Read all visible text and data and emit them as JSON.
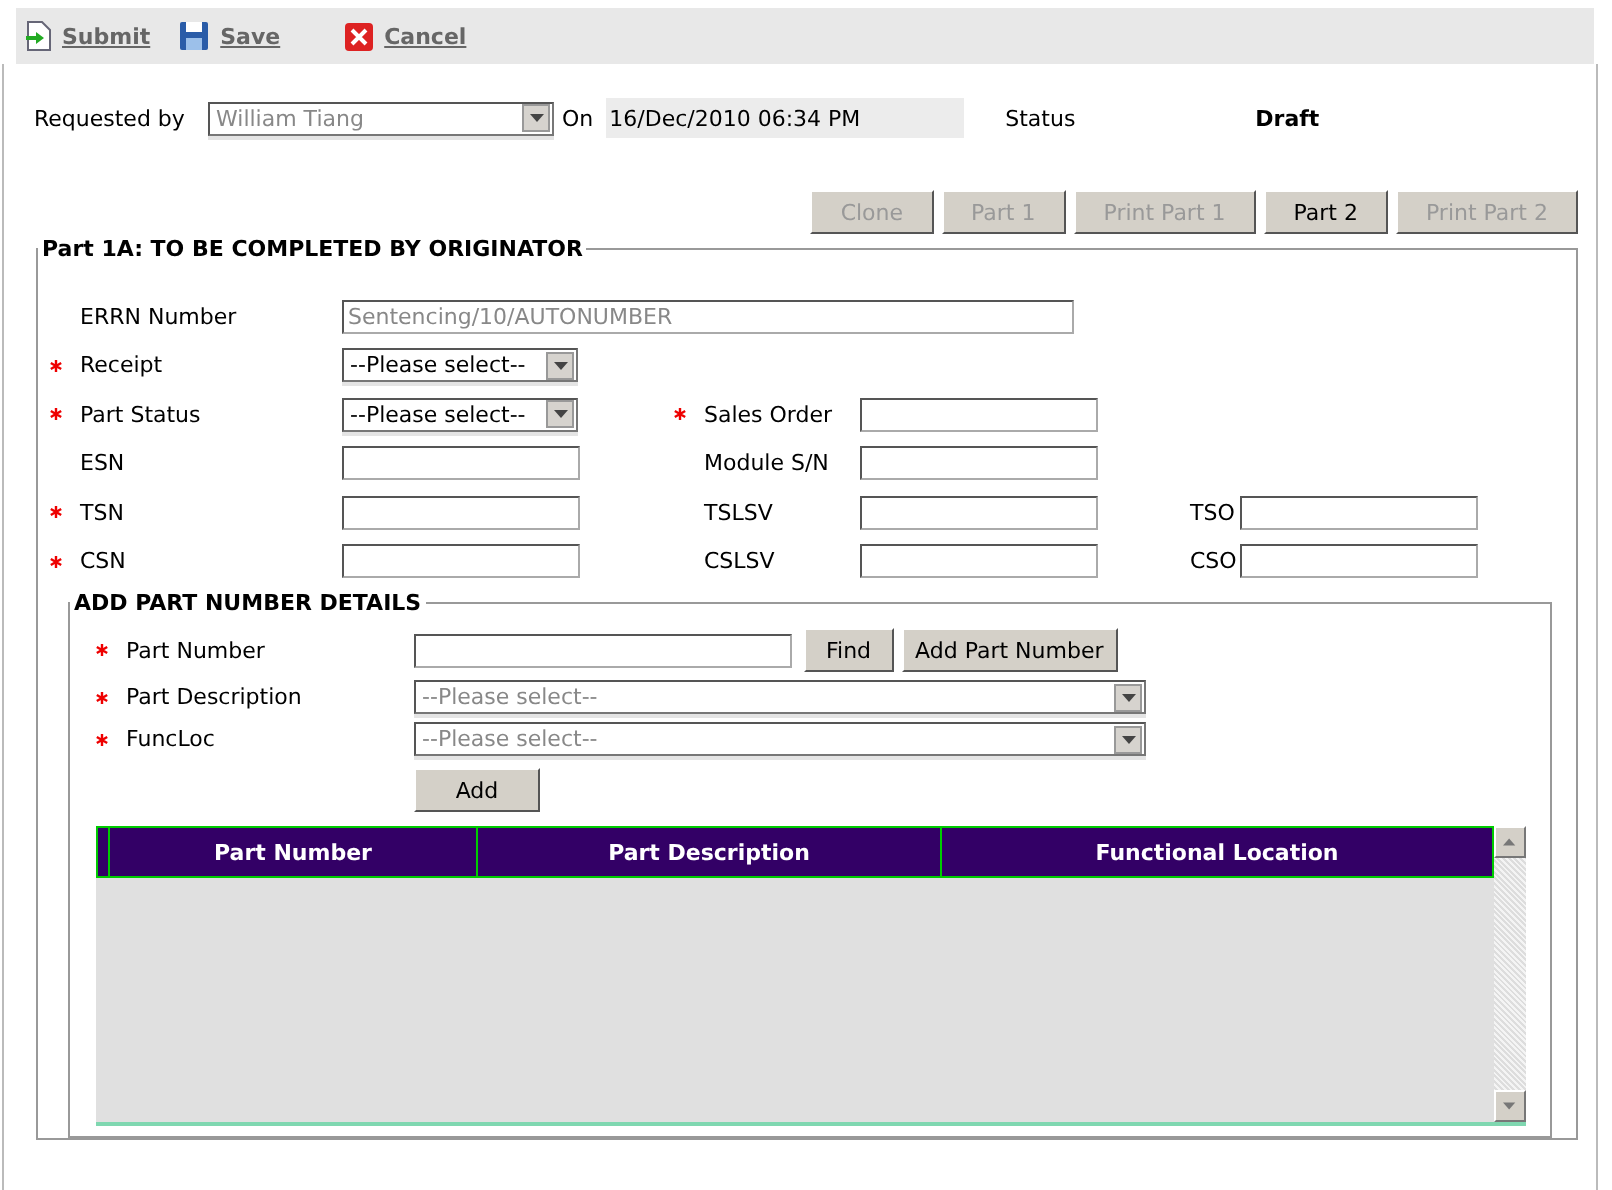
{
  "toolbar": [
    {
      "kind": "submit",
      "label": "Submit"
    },
    {
      "kind": "save",
      "label": "Save"
    },
    {
      "kind": "cancel",
      "label": "Cancel"
    }
  ],
  "header": {
    "requested_by_label": "Requested by",
    "requested_by": "William Tiang",
    "on_label": "On",
    "date": "16/Dec/2010 06:34 PM",
    "status_label": "Status",
    "status": "Draft"
  },
  "buttons": [
    {
      "label": "Clone",
      "disabled": true
    },
    {
      "label": "Part 1",
      "disabled": true
    },
    {
      "label": "Print Part 1",
      "disabled": true
    },
    {
      "label": "Part 2",
      "disabled": false
    },
    {
      "label": "Print Part 2",
      "disabled": true
    }
  ],
  "section": {
    "legend": "Part 1A: TO BE COMPLETED BY ORIGINATOR",
    "rows": [
      [
        {
          "label": "ERRN Number",
          "required": false,
          "kind": "wide",
          "value": "Sentencing/10/AUTONUMBER"
        }
      ],
      [
        {
          "label": "Receipt",
          "required": true,
          "kind": "select",
          "value": "--Please select--"
        }
      ],
      [
        {
          "label": "Part Status",
          "required": true,
          "kind": "select",
          "value": "--Please select--"
        },
        {
          "label": "Sales Order",
          "required": true,
          "kind": "text"
        }
      ],
      [
        {
          "label": "ESN",
          "required": false,
          "kind": "text"
        },
        {
          "label": "Module S/N",
          "required": false,
          "kind": "text"
        }
      ],
      [
        {
          "label": "TSN",
          "required": true,
          "kind": "text"
        },
        {
          "label": "TSLSV",
          "required": false,
          "kind": "text"
        },
        {
          "label": "TSO",
          "required": false,
          "kind": "text"
        }
      ],
      [
        {
          "label": "CSN",
          "required": true,
          "kind": "text"
        },
        {
          "label": "CSLSV",
          "required": false,
          "kind": "text"
        },
        {
          "label": "CSO",
          "required": false,
          "kind": "text"
        }
      ]
    ]
  },
  "part_details": {
    "legend": "ADD PART NUMBER DETAILS",
    "part_number_label": "Part Number",
    "part_number_required": true,
    "part_description_required": true,
    "funcloc_required": true,
    "find": "Find",
    "add_part_number": "Add Part Number",
    "part_description_label": "Part Description",
    "part_description": "--Please select--",
    "funcloc_label": "FuncLoc",
    "funcloc": "--Please select--",
    "add": "Add",
    "table": {
      "columns": [
        "Part Number",
        "Part Description",
        "Functional Location"
      ]
    }
  }
}
